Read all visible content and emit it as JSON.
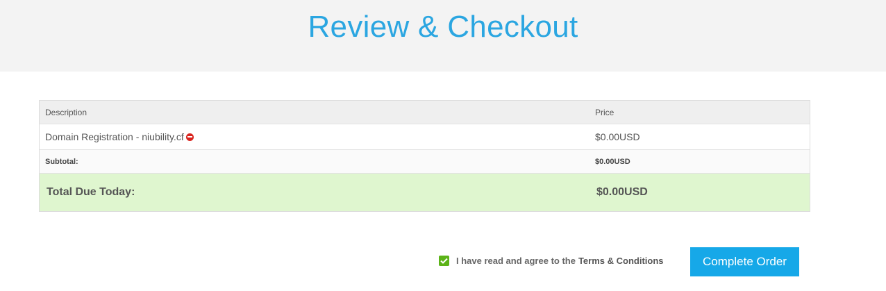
{
  "page": {
    "title": "Review & Checkout"
  },
  "table": {
    "headers": {
      "description": "Description",
      "price": "Price"
    },
    "items": [
      {
        "description": "Domain Registration - niubility.cf",
        "price": "$0.00USD"
      }
    ],
    "subtotal": {
      "label": "Subtotal:",
      "value": "$0.00USD"
    },
    "total": {
      "label": "Total Due Today:",
      "value": "$0.00USD"
    }
  },
  "agreement": {
    "text": "I have read and agree to the",
    "link": "Terms & Conditions",
    "checked": true
  },
  "actions": {
    "complete_order": "Complete Order"
  },
  "colors": {
    "title": "#2ba6e1",
    "total_bg": "#dff6cf",
    "button": "#16a8e8",
    "remove_icon": "#d9231d",
    "checkbox": "#5cb318"
  },
  "icons": {
    "remove": "remove-circle-icon",
    "checkbox": "checkmark-icon"
  }
}
